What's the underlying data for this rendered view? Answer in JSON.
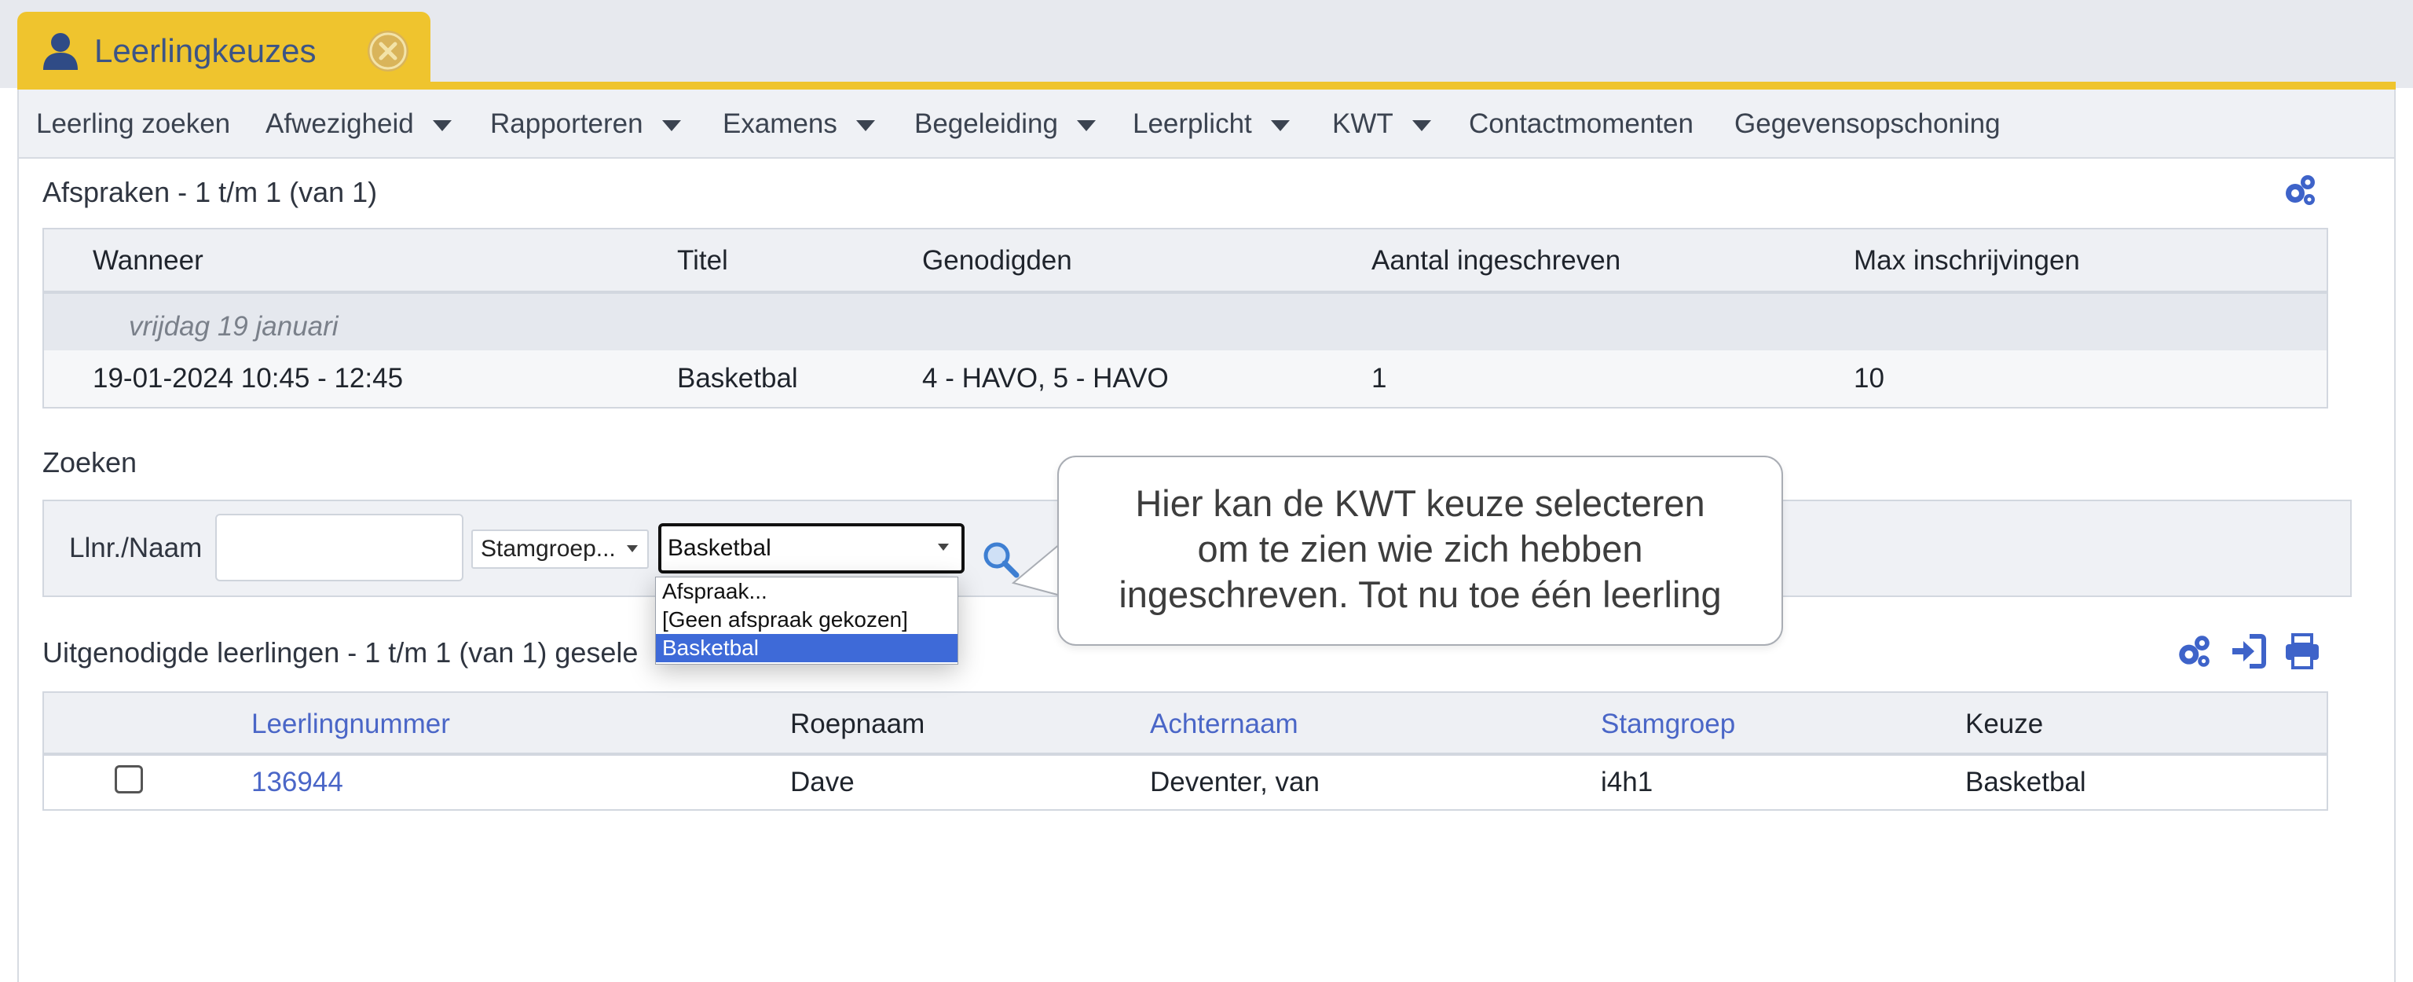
{
  "tab": {
    "title": "Leerlingkeuzes",
    "icon": "user-icon",
    "close_icon": "close-circle-icon"
  },
  "menu": [
    {
      "label": "Leerling zoeken",
      "has_caret": false
    },
    {
      "label": "Afwezigheid",
      "has_caret": true
    },
    {
      "label": "Rapporteren",
      "has_caret": true
    },
    {
      "label": "Examens",
      "has_caret": true
    },
    {
      "label": "Begeleiding",
      "has_caret": true
    },
    {
      "label": "Leerplicht",
      "has_caret": true
    },
    {
      "label": "KWT",
      "has_caret": true
    },
    {
      "label": "Contactmomenten",
      "has_caret": false
    },
    {
      "label": "Gegevensopschoning",
      "has_caret": false
    }
  ],
  "appointments": {
    "title": "Afspraken - 1 t/m 1 (van 1)",
    "columns": [
      "Wanneer",
      "Titel",
      "Genodigden",
      "Aantal ingeschreven",
      "Max inschrijvingen"
    ],
    "group_label": "vrijdag 19 januari",
    "rows": [
      [
        "19-01-2024 10:45 - 12:45",
        "Basketbal",
        "4 - HAVO, 5 - HAVO",
        "1",
        "10"
      ]
    ]
  },
  "search": {
    "title": "Zoeken",
    "name_label": "Llnr./Naam",
    "name_value": "",
    "stamgroep_value": "Stamgroep...",
    "keuze_value": "Basketbal",
    "dropdown_options": [
      "Afspraak...",
      "[Geen afspraak gekozen]",
      "Basketbal"
    ],
    "dropdown_selected_index": 2
  },
  "callout": {
    "line1": "Hier kan de KWT keuze selecteren",
    "line2": "om te zien wie zich hebben",
    "line3": "ingeschreven. Tot nu toe één leerling"
  },
  "students": {
    "title": "Uitgenodigde leerlingen - 1 t/m 1 (van 1) gesele",
    "columns": [
      "Leerlingnummer",
      "Roepnaam",
      "Achternaam",
      "Stamgroep",
      "Keuze"
    ],
    "rows": [
      {
        "checked": false,
        "cells": [
          "136944",
          "Dave",
          "Deventer, van",
          "i4h1",
          "Basketbal"
        ]
      }
    ]
  },
  "colors": {
    "accent": "#efc42e",
    "link": "#4a66c7",
    "icon_blue": "#3e63c9"
  }
}
